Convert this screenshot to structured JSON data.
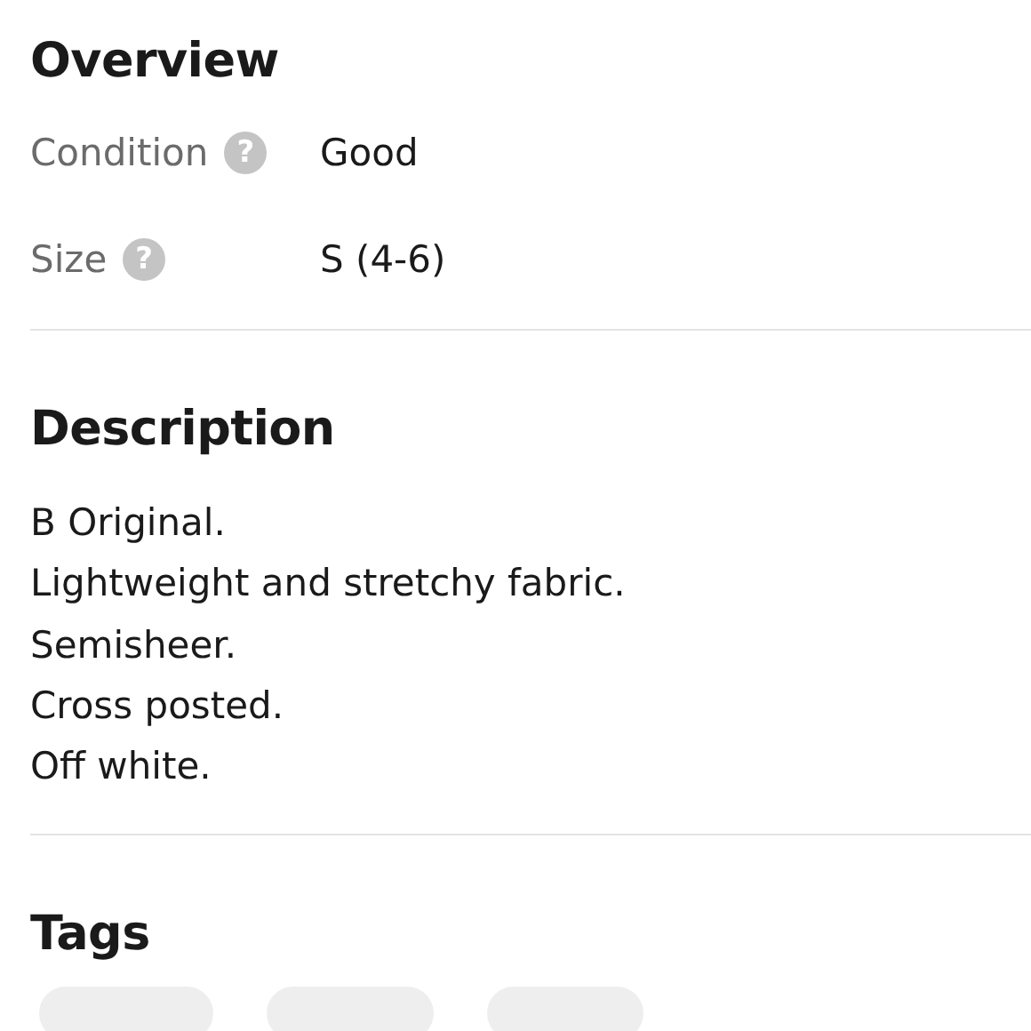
{
  "overview": {
    "title": "Overview",
    "rows": [
      {
        "label": "Condition",
        "help_icon": "?",
        "value": "Good"
      },
      {
        "label": "Size",
        "help_icon": "?",
        "value": "S (4-6)"
      }
    ]
  },
  "description": {
    "title": "Description",
    "lines": [
      "B Original.",
      "Lightweight and stretchy fabric.",
      "Semisheer.",
      "Cross posted.",
      "Off white."
    ]
  },
  "tags": {
    "title": "Tags",
    "chips": [
      {
        "kind": "chip"
      },
      {
        "kind": "chip"
      },
      {
        "kind": "chip"
      }
    ]
  }
}
